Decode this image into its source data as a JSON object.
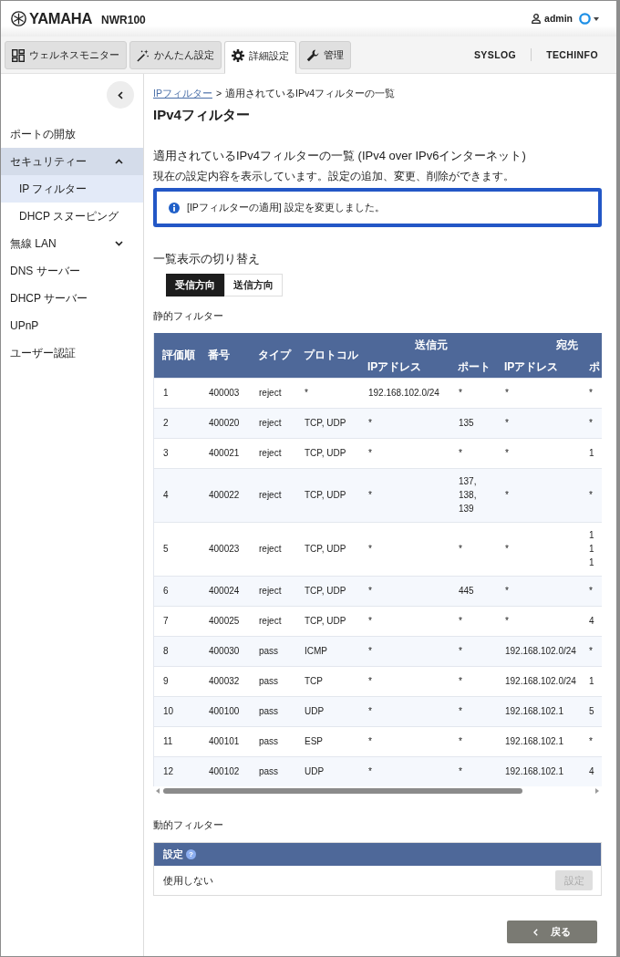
{
  "header": {
    "logo": "YAMAHA",
    "model": "NWR100",
    "user": "admin"
  },
  "tabs": [
    {
      "label": "ウェルネスモニター",
      "kind": "dashboard",
      "selected": false
    },
    {
      "label": "かんたん設定",
      "kind": "wizard",
      "selected": false
    },
    {
      "label": "詳細設定",
      "kind": "gear",
      "selected": true
    },
    {
      "label": "管理",
      "kind": "wrench",
      "selected": false
    }
  ],
  "links": [
    "SYSLOG",
    "TECHINFO"
  ],
  "sidebar": {
    "items": [
      {
        "label": "ポートの開放",
        "selected": false
      },
      {
        "label": "セキュリティー",
        "selected": false,
        "expanded": true,
        "children": [
          {
            "label": "IP フィルター",
            "selected": true
          },
          {
            "label": "DHCP スヌーピング",
            "selected": false
          }
        ]
      },
      {
        "label": "無線 LAN",
        "selected": false,
        "expanded": false
      },
      {
        "label": "DNS サーバー",
        "selected": false
      },
      {
        "label": "DHCP サーバー",
        "selected": false
      },
      {
        "label": "UPnP",
        "selected": false
      },
      {
        "label": "ユーザー認証",
        "selected": false
      }
    ]
  },
  "breadcrumb": {
    "link": "IPフィルター",
    "separator": ">",
    "current": "適用されているIPv4フィルターの一覧"
  },
  "title": "IPv4フィルター",
  "section": {
    "heading": "適用されているIPv4フィルターの一覧 (IPv4 over IPv6インターネット)",
    "description": "現在の設定内容を表示しています。設定の追加、変更、削除ができます。",
    "alert": "[IPフィルターの適用] 設定を変更しました。"
  },
  "view_switch": {
    "heading": "一覧表示の切り替え",
    "options": [
      {
        "label": "受信方向",
        "selected": true
      },
      {
        "label": "送信方向",
        "selected": false
      }
    ]
  },
  "static_filter": {
    "label": "静的フィルター",
    "columns": [
      "評価順",
      "番号",
      "タイプ",
      "プロトコル"
    ],
    "column_groups": [
      {
        "label": "送信元",
        "columns": [
          "IPアドレス",
          "ポート"
        ]
      },
      {
        "label": "宛先",
        "columns": [
          "IPアドレス",
          "ポ"
        ]
      }
    ],
    "rows": [
      [
        "1",
        "400003",
        "reject",
        "*",
        "192.168.102.0/24",
        "*",
        "*",
        "*"
      ],
      [
        "2",
        "400020",
        "reject",
        "TCP, UDP",
        "*",
        "135",
        "*",
        "*"
      ],
      [
        "3",
        "400021",
        "reject",
        "TCP, UDP",
        "*",
        "*",
        "*",
        "1"
      ],
      [
        "4",
        "400022",
        "reject",
        "TCP, UDP",
        "*",
        "137, 138, 139",
        "*",
        "*"
      ],
      [
        "5",
        "400023",
        "reject",
        "TCP, UDP",
        "*",
        "*",
        "*",
        "1 1 1"
      ],
      [
        "6",
        "400024",
        "reject",
        "TCP, UDP",
        "*",
        "445",
        "*",
        "*"
      ],
      [
        "7",
        "400025",
        "reject",
        "TCP, UDP",
        "*",
        "*",
        "*",
        "4"
      ],
      [
        "8",
        "400030",
        "pass",
        "ICMP",
        "*",
        "*",
        "192.168.102.0/24",
        "*"
      ],
      [
        "9",
        "400032",
        "pass",
        "TCP",
        "*",
        "*",
        "192.168.102.0/24",
        "1"
      ],
      [
        "10",
        "400100",
        "pass",
        "UDP",
        "*",
        "*",
        "192.168.102.1",
        "5"
      ],
      [
        "11",
        "400101",
        "pass",
        "ESP",
        "*",
        "*",
        "192.168.102.1",
        "*"
      ],
      [
        "12",
        "400102",
        "pass",
        "UDP",
        "*",
        "*",
        "192.168.102.1",
        "4"
      ]
    ]
  },
  "dynamic_filter": {
    "label": "動的フィルター",
    "header": "設定",
    "help": "?",
    "value": "使用しない",
    "button": {
      "label": "設定",
      "disabled": true
    }
  },
  "back_button": "戻る"
}
